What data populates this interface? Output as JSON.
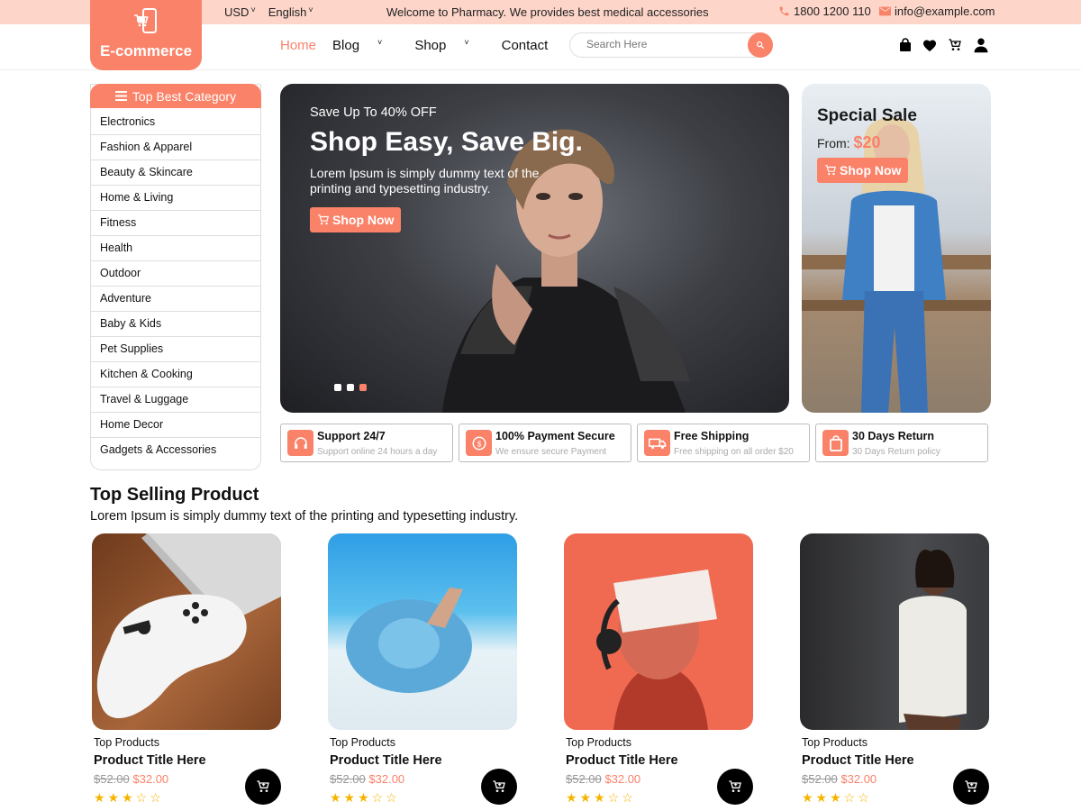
{
  "topbar": {
    "currency": "USD",
    "language": "English",
    "welcome": "Welcome to Pharmacy. We provides best medical accessories",
    "phone": "1800 1200 110",
    "email": "info@example.com"
  },
  "header": {
    "logo_text": "E-commerce",
    "nav": [
      "Home",
      "Blog",
      "Shop",
      "Contact"
    ],
    "search_placeholder": "Search Here"
  },
  "sidebar": {
    "title": "Top Best Category",
    "items": [
      "Electronics",
      "Fashion & Apparel",
      "Beauty & Skincare",
      "Home & Living",
      "Fitness",
      "Health",
      "Outdoor",
      "Adventure",
      "Baby & Kids",
      "Pet Supplies",
      "Kitchen & Cooking",
      "Travel & Luggage",
      "Home Decor",
      "Gadgets & Accessories"
    ]
  },
  "hero": {
    "eyebrow": "Save Up To 40% OFF",
    "title": "Shop Easy, Save Big.",
    "text": "Lorem Ipsum is simply dummy text of the printing and typesetting industry.",
    "button": "Shop Now"
  },
  "side_banner": {
    "title": "Special Sale",
    "from_label": "From:",
    "price": "$20",
    "button": "Shop Now"
  },
  "features": [
    {
      "title": "Support 24/7",
      "subtitle": "Support online 24 hours a day",
      "icon": "headset-icon"
    },
    {
      "title": "100% Payment Secure",
      "subtitle": "We ensure secure Payment",
      "icon": "coin-icon"
    },
    {
      "title": "Free Shipping",
      "subtitle": "Free shipping on all order $20",
      "icon": "truck-icon"
    },
    {
      "title": "30 Days Return",
      "subtitle": "30 Days Return policy",
      "icon": "bag-icon"
    }
  ],
  "section": {
    "title": "Top Selling Product",
    "subtitle": "Lorem Ipsum is simply dummy text of the printing and typesetting industry."
  },
  "products": [
    {
      "category": "Top Products",
      "title": "Product Title Here",
      "old_price": "$52.00",
      "price": "$32.00",
      "rating": 3,
      "image": "game-controller"
    },
    {
      "category": "Top Products",
      "title": "Product Title Here",
      "old_price": "$52.00",
      "price": "$32.00",
      "rating": 3,
      "image": "beach-hat"
    },
    {
      "category": "Top Products",
      "title": "Product Title Here",
      "old_price": "$52.00",
      "price": "$32.00",
      "rating": 3,
      "image": "vr-headset"
    },
    {
      "category": "Top Products",
      "title": "Product Title Here",
      "old_price": "$52.00",
      "price": "$32.00",
      "rating": 3,
      "image": "knit-dress"
    }
  ],
  "colors": {
    "accent": "#fa8269",
    "topbar": "#fdd5c9"
  }
}
